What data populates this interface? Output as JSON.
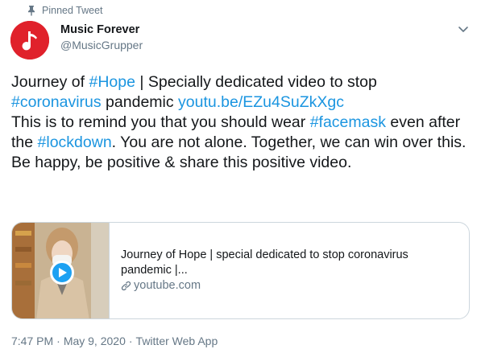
{
  "pinned": {
    "label": "Pinned Tweet",
    "icon": "pin-icon"
  },
  "author": {
    "display_name": "Music Forever",
    "handle": "@MusicGrupper",
    "avatar_color": "#e0212b",
    "avatar_icon": "music-note-icon"
  },
  "menu_icon": "chevron-down-icon",
  "tweet": {
    "p1": "Journey of ",
    "h1": "#Hope",
    "p2": " | Specially dedicated video to stop ",
    "h2": "#coronavirus",
    "p3": " pandemic ",
    "url": "youtu.be/EZu4SuZkXgc",
    "p4": "This is to remind you that you should wear ",
    "h3": "#facemask",
    "p5": " even after the ",
    "h4": "#lockdown",
    "p6": ". You are not alone. Together, we can win over this. Be happy, be positive & share this positive video."
  },
  "card": {
    "title_line1": "Journey of Hope | special dedicated to stop coronavirus",
    "title_line2": "pandemic |...",
    "domain": "youtube.com"
  },
  "meta": {
    "time": "7:47 PM",
    "separator": "·",
    "date": "May 9, 2020",
    "source": "Twitter Web App"
  },
  "colors": {
    "link": "#1b95e0",
    "secondary": "#657786",
    "border": "#ccd6dd",
    "play": "#1da1f2"
  }
}
